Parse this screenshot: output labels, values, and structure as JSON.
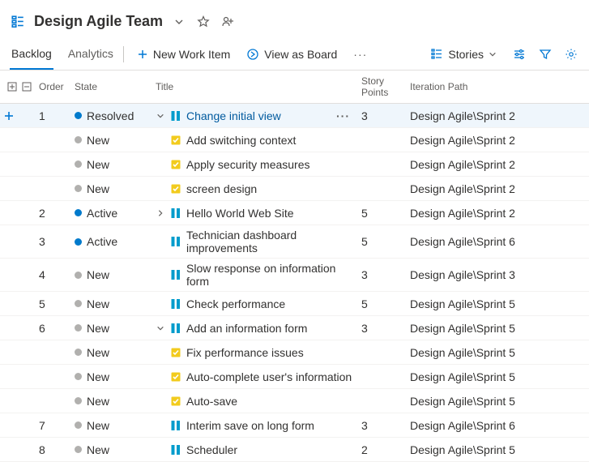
{
  "header": {
    "title": "Design Agile Team"
  },
  "tabs": {
    "backlog": "Backlog",
    "analytics": "Analytics"
  },
  "commands": {
    "newItem": "New Work Item",
    "viewBoard": "View as Board",
    "stories": "Stories"
  },
  "columns": {
    "order": "Order",
    "state": "State",
    "title": "Title",
    "points": "Story Points",
    "iteration": "Iteration Path"
  },
  "states": {
    "resolved": {
      "label": "Resolved",
      "color": "#007acc"
    },
    "active": {
      "label": "Active",
      "color": "#007acc"
    },
    "new": {
      "label": "New",
      "color": "#b1b0ae"
    }
  },
  "rows": [
    {
      "order": "1",
      "state": "resolved",
      "expand": "open",
      "kind": "story",
      "title": "Change initial view",
      "link": true,
      "points": "3",
      "iter": "Design Agile\\Sprint 2",
      "selected": true,
      "menu": true
    },
    {
      "order": "",
      "state": "new",
      "expand": "none",
      "kind": "task",
      "title": "Add switching context",
      "link": false,
      "points": "",
      "iter": "Design Agile\\Sprint 2",
      "indent": 1
    },
    {
      "order": "",
      "state": "new",
      "expand": "none",
      "kind": "task",
      "title": "Apply security measures",
      "link": false,
      "points": "",
      "iter": "Design Agile\\Sprint 2",
      "indent": 1
    },
    {
      "order": "",
      "state": "new",
      "expand": "none",
      "kind": "task",
      "title": "screen design",
      "link": false,
      "points": "",
      "iter": "Design Agile\\Sprint 2",
      "indent": 1
    },
    {
      "order": "2",
      "state": "active",
      "expand": "closed",
      "kind": "story",
      "title": "Hello World Web Site",
      "link": false,
      "points": "5",
      "iter": "Design Agile\\Sprint 2"
    },
    {
      "order": "3",
      "state": "active",
      "expand": "none",
      "kind": "story",
      "title": "Technician dashboard improvements",
      "link": false,
      "points": "5",
      "iter": "Design Agile\\Sprint 6"
    },
    {
      "order": "4",
      "state": "new",
      "expand": "none",
      "kind": "story",
      "title": "Slow response on information form",
      "link": false,
      "points": "3",
      "iter": "Design Agile\\Sprint 3"
    },
    {
      "order": "5",
      "state": "new",
      "expand": "none",
      "kind": "story",
      "title": "Check performance",
      "link": false,
      "points": "5",
      "iter": "Design Agile\\Sprint 5"
    },
    {
      "order": "6",
      "state": "new",
      "expand": "open",
      "kind": "story",
      "title": "Add an information form",
      "link": false,
      "points": "3",
      "iter": "Design Agile\\Sprint 5"
    },
    {
      "order": "",
      "state": "new",
      "expand": "none",
      "kind": "task",
      "title": "Fix performance issues",
      "link": false,
      "points": "",
      "iter": "Design Agile\\Sprint 5",
      "indent": 1
    },
    {
      "order": "",
      "state": "new",
      "expand": "none",
      "kind": "task",
      "title": "Auto-complete user's information",
      "link": false,
      "points": "",
      "iter": "Design Agile\\Sprint 5",
      "indent": 1
    },
    {
      "order": "",
      "state": "new",
      "expand": "none",
      "kind": "task",
      "title": "Auto-save",
      "link": false,
      "points": "",
      "iter": "Design Agile\\Sprint 5",
      "indent": 1
    },
    {
      "order": "7",
      "state": "new",
      "expand": "none",
      "kind": "story",
      "title": "Interim save on long form",
      "link": false,
      "points": "3",
      "iter": "Design Agile\\Sprint 6"
    },
    {
      "order": "8",
      "state": "new",
      "expand": "none",
      "kind": "story",
      "title": "Scheduler",
      "link": false,
      "points": "2",
      "iter": "Design Agile\\Sprint 5"
    }
  ]
}
